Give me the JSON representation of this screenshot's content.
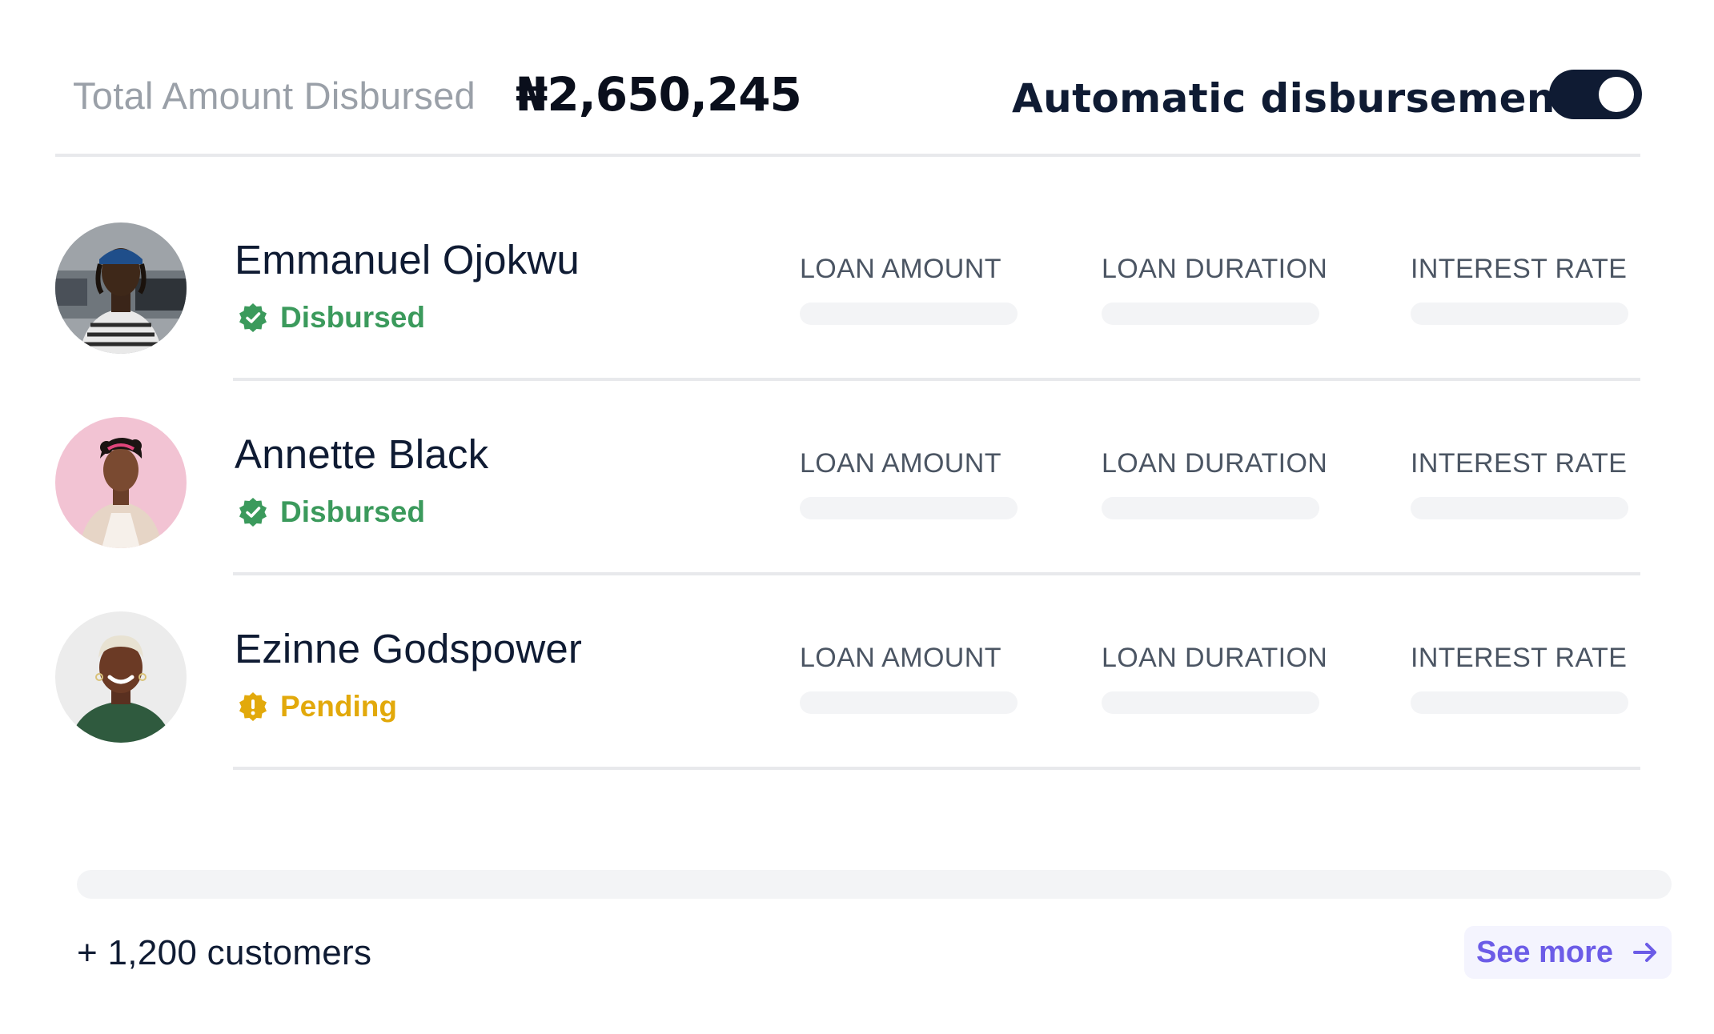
{
  "header": {
    "total_label": "Total Amount Disbursed",
    "total_value": "₦2,650,245",
    "auto_label": "Automatic disbursement",
    "auto_toggle_on": true
  },
  "columns": [
    "LOAN AMOUNT",
    "LOAN DURATION",
    "INTEREST RATE"
  ],
  "customers": [
    {
      "name": "Emmanuel Ojokwu",
      "status": "Disbursed",
      "status_icon": "check-badge-icon",
      "status_color": "#3b9a5c"
    },
    {
      "name": "Annette Black",
      "status": "Disbursed",
      "status_icon": "check-badge-icon",
      "status_color": "#3b9a5c"
    },
    {
      "name": "Ezinne Godspower",
      "status": "Pending",
      "status_icon": "alert-badge-icon",
      "status_color": "#e2a90b"
    }
  ],
  "footer": {
    "customers_count": "+ 1,200 customers",
    "see_more_label": "See more",
    "see_more_icon": "arrow-right-icon"
  },
  "colors": {
    "primary": "#0f1b33",
    "accent": "#6c5ce7",
    "success": "#3b9a5c",
    "warning": "#e2a90b"
  }
}
